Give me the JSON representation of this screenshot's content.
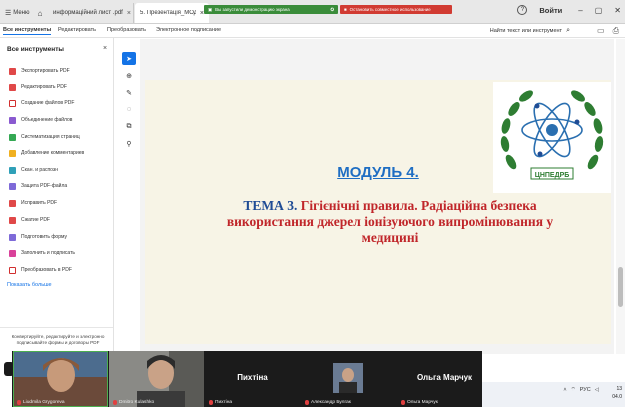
{
  "browser": {
    "menu_label": "Меню",
    "tabs": [
      {
        "title": "информаційний лист .pdf",
        "close": "×"
      },
      {
        "title": "5. Презентація_МОДУЛЬ",
        "close": "×"
      }
    ],
    "share_notice": "Вы запустили демонстрацию экрана",
    "share_stop": "Остановить совместное использование",
    "login_label": "Войти",
    "help_label": "?"
  },
  "toolbar": {
    "items": [
      "Все инструменты",
      "Редактировать",
      "Преобразовать",
      "Электронное подписание"
    ],
    "search_label": "Найти текст или инструмент"
  },
  "panel": {
    "title": "Все инструменты",
    "close": "×",
    "tools": [
      {
        "label": "Экспортировать PDF",
        "icon": "export-pdf-icon"
      },
      {
        "label": "Редактировать PDF",
        "icon": "edit-pdf-icon"
      },
      {
        "label": "Создание файлов PDF",
        "icon": "create-pdf-icon"
      },
      {
        "label": "Объединение файлов",
        "icon": "combine-files-icon"
      },
      {
        "label": "Систематизация страниц",
        "icon": "organize-pages-icon"
      },
      {
        "label": "Добавление комментариев",
        "icon": "comment-icon"
      },
      {
        "label": "Скан. и распозн",
        "icon": "scan-icon"
      },
      {
        "label": "Защита PDF-файла",
        "icon": "protect-pdf-icon"
      },
      {
        "label": "Исправить PDF",
        "icon": "redact-pdf-icon"
      },
      {
        "label": "Сжатие PDF",
        "icon": "compress-pdf-icon"
      },
      {
        "label": "Подготовить форму",
        "icon": "prepare-form-icon"
      },
      {
        "label": "Заполнить и подписать",
        "icon": "fill-sign-icon"
      },
      {
        "label": "Преобразовать в PDF",
        "icon": "convert-pdf-icon"
      }
    ],
    "show_less": "Показать больше",
    "promo": "Конвертируйте, редактируйте и электронно подписывайте формы и договоры PDF"
  },
  "slide": {
    "module": "МОДУЛЬ 4.",
    "theme_lead": "ТЕМА 3.",
    "theme_rest": "Гігієнічні правила. Радіаційна безпека використання джерел іонізуючого випромінювання у медицині",
    "logo_text": "ЦНПЕДРБ"
  },
  "participants": [
    {
      "name": "Liudmila Grygoreva",
      "kind": "video"
    },
    {
      "name": "Dmitro Kulashko",
      "kind": "video"
    },
    {
      "name": "Пихтіна",
      "big": "Пихтіна",
      "kind": "name"
    },
    {
      "name": "Александр Булгак",
      "kind": "avatar"
    },
    {
      "name": "Ольга Марчук",
      "big": "Ольга Марчук",
      "kind": "name"
    }
  ],
  "taskbar": {
    "lang": "РУС",
    "time": "13",
    "date": "04.0"
  },
  "colors": {
    "accent": "#1473e6",
    "share_green": "#3a8c3a",
    "share_red": "#d13b32",
    "module_blue": "#1f6ec3",
    "theme_red": "#c0262a"
  }
}
